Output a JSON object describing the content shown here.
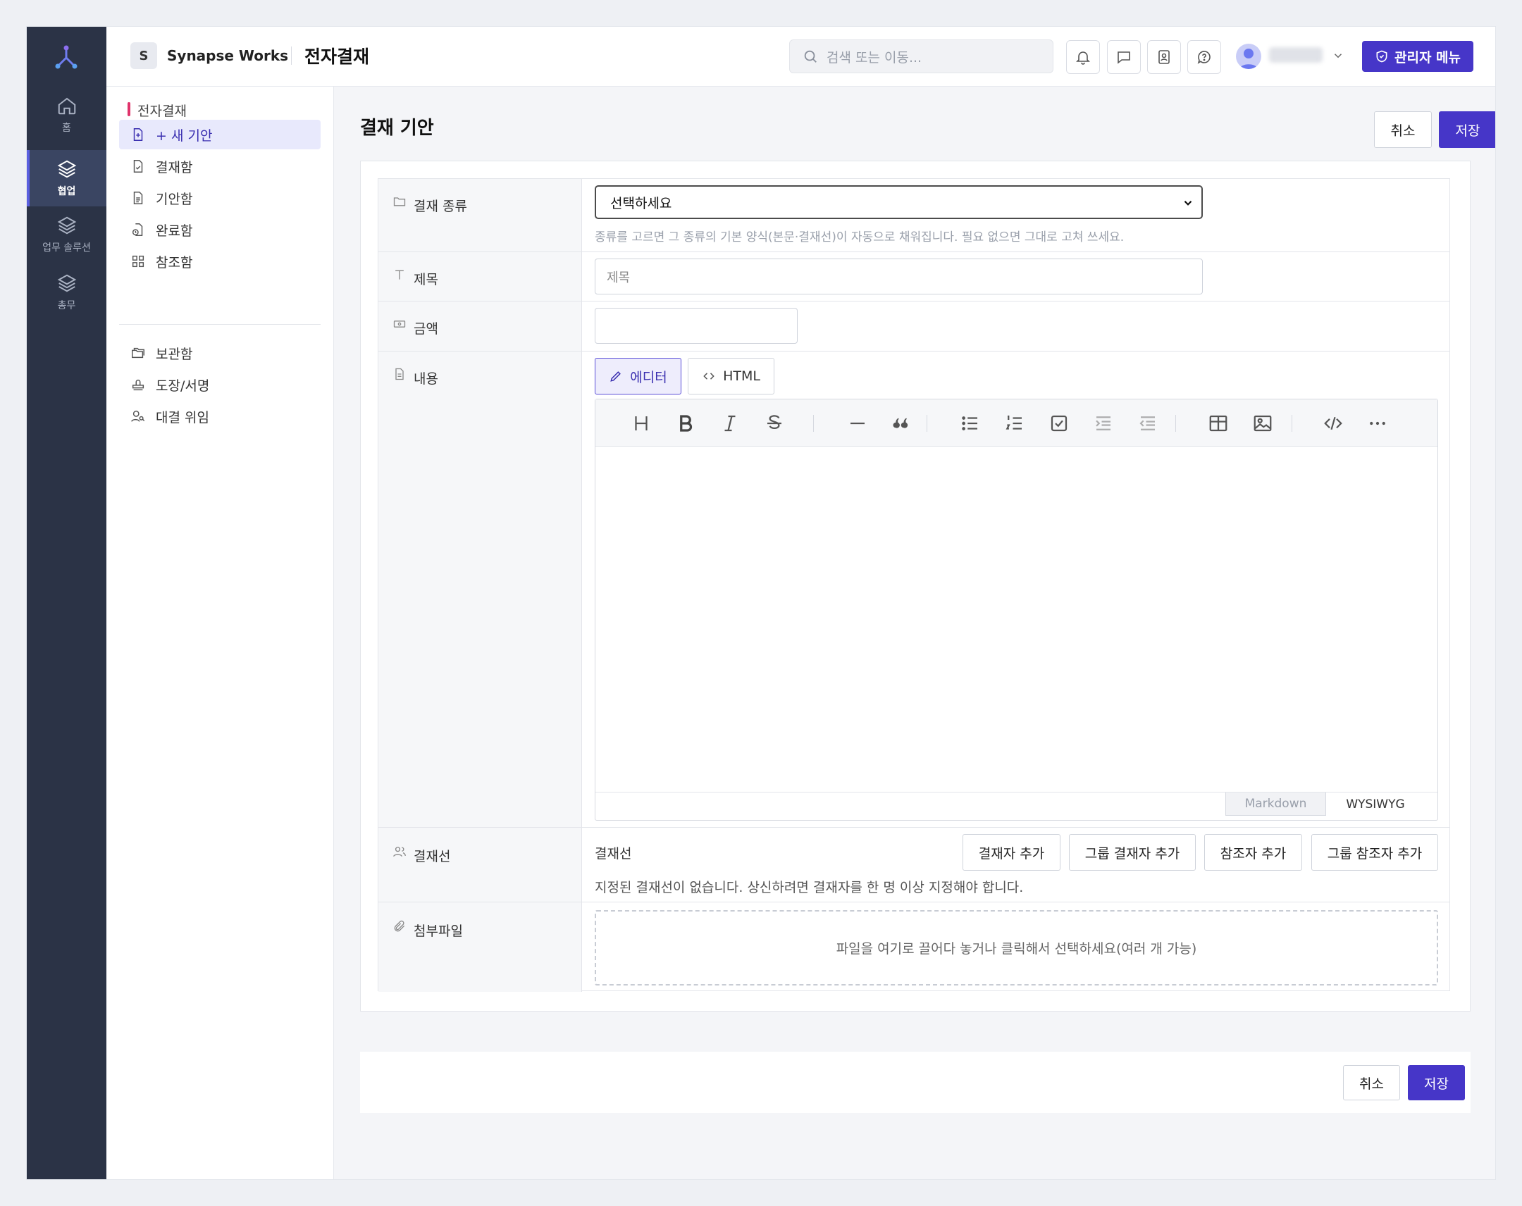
{
  "rail": {
    "items": [
      {
        "label": "홈",
        "icon": "home-icon"
      },
      {
        "label": "협업",
        "icon": "layers-icon",
        "active": true
      },
      {
        "label": "업무 솔루션",
        "icon": "layers-icon"
      },
      {
        "label": "총무",
        "icon": "layers-icon"
      }
    ]
  },
  "header": {
    "workspace_badge": "S",
    "workspace_name": "Synapse Works",
    "page_name": "전자결재",
    "search_placeholder": "검색 또는 이동...",
    "admin_label": "관리자 메뉴",
    "icons": [
      "bell-icon",
      "chat-icon",
      "contacts-icon",
      "help-icon"
    ]
  },
  "sidebar": {
    "section_title": "전자결재",
    "items": [
      {
        "label": "+ 새 기안",
        "icon": "file-plus-icon",
        "active": true
      },
      {
        "label": "결재함",
        "icon": "file-check-icon"
      },
      {
        "label": "기안함",
        "icon": "file-text-icon"
      },
      {
        "label": "완료함",
        "icon": "file-clock-icon"
      },
      {
        "label": "참조함",
        "icon": "grid-icon"
      }
    ],
    "items2": [
      {
        "label": "보관함",
        "icon": "folders-icon"
      },
      {
        "label": "도장/서명",
        "icon": "stamp-icon"
      },
      {
        "label": "대결 위임",
        "icon": "user-key-icon"
      }
    ]
  },
  "form": {
    "title": "결재 기안",
    "cancel_label": "취소",
    "save_label": "저장",
    "type": {
      "label": "결재 종류",
      "selected": "선택하세요",
      "hint": "종류를 고르면 그 종류의 기본 양식(본문·결재선)이 자동으로 채워집니다. 필요 없으면 그대로 고쳐 쓰세요."
    },
    "subject": {
      "label": "제목",
      "placeholder": "제목"
    },
    "amount": {
      "label": "금액",
      "value": ""
    },
    "content": {
      "label": "내용",
      "mode_editor": "에디터",
      "mode_html": "HTML",
      "tab_markdown": "Markdown",
      "tab_wysiwyg": "WYSIWYG"
    },
    "approval_line": {
      "label": "결재선",
      "title": "결재선",
      "buttons": [
        "결재자 추가",
        "그룹 결재자 추가",
        "참조자 추가",
        "그룹 참조자 추가"
      ],
      "empty_hint": "지정된 결재선이 없습니다. 상신하려면 결재자를 한 명 이상 지정해야 합니다."
    },
    "attachment": {
      "label": "첨부파일",
      "dropzone_text": "파일을 여기로 끌어다 놓거나 클릭해서 선택하세요(여러 개 가능)"
    }
  },
  "colors": {
    "primary": "#4636c8",
    "rail": "#2b3346",
    "accent_bar": "#e0336b"
  }
}
